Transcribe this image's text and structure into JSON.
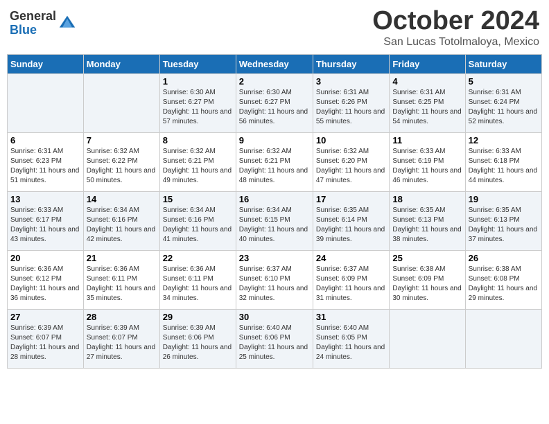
{
  "logo": {
    "general": "General",
    "blue": "Blue"
  },
  "header": {
    "month": "October 2024",
    "location": "San Lucas Totolmaloya, Mexico"
  },
  "days_of_week": [
    "Sunday",
    "Monday",
    "Tuesday",
    "Wednesday",
    "Thursday",
    "Friday",
    "Saturday"
  ],
  "weeks": [
    [
      {
        "day": "",
        "sunrise": "",
        "sunset": "",
        "daylight": ""
      },
      {
        "day": "",
        "sunrise": "",
        "sunset": "",
        "daylight": ""
      },
      {
        "day": "1",
        "sunrise": "Sunrise: 6:30 AM",
        "sunset": "Sunset: 6:27 PM",
        "daylight": "Daylight: 11 hours and 57 minutes."
      },
      {
        "day": "2",
        "sunrise": "Sunrise: 6:30 AM",
        "sunset": "Sunset: 6:27 PM",
        "daylight": "Daylight: 11 hours and 56 minutes."
      },
      {
        "day": "3",
        "sunrise": "Sunrise: 6:31 AM",
        "sunset": "Sunset: 6:26 PM",
        "daylight": "Daylight: 11 hours and 55 minutes."
      },
      {
        "day": "4",
        "sunrise": "Sunrise: 6:31 AM",
        "sunset": "Sunset: 6:25 PM",
        "daylight": "Daylight: 11 hours and 54 minutes."
      },
      {
        "day": "5",
        "sunrise": "Sunrise: 6:31 AM",
        "sunset": "Sunset: 6:24 PM",
        "daylight": "Daylight: 11 hours and 52 minutes."
      }
    ],
    [
      {
        "day": "6",
        "sunrise": "Sunrise: 6:31 AM",
        "sunset": "Sunset: 6:23 PM",
        "daylight": "Daylight: 11 hours and 51 minutes."
      },
      {
        "day": "7",
        "sunrise": "Sunrise: 6:32 AM",
        "sunset": "Sunset: 6:22 PM",
        "daylight": "Daylight: 11 hours and 50 minutes."
      },
      {
        "day": "8",
        "sunrise": "Sunrise: 6:32 AM",
        "sunset": "Sunset: 6:21 PM",
        "daylight": "Daylight: 11 hours and 49 minutes."
      },
      {
        "day": "9",
        "sunrise": "Sunrise: 6:32 AM",
        "sunset": "Sunset: 6:21 PM",
        "daylight": "Daylight: 11 hours and 48 minutes."
      },
      {
        "day": "10",
        "sunrise": "Sunrise: 6:32 AM",
        "sunset": "Sunset: 6:20 PM",
        "daylight": "Daylight: 11 hours and 47 minutes."
      },
      {
        "day": "11",
        "sunrise": "Sunrise: 6:33 AM",
        "sunset": "Sunset: 6:19 PM",
        "daylight": "Daylight: 11 hours and 46 minutes."
      },
      {
        "day": "12",
        "sunrise": "Sunrise: 6:33 AM",
        "sunset": "Sunset: 6:18 PM",
        "daylight": "Daylight: 11 hours and 44 minutes."
      }
    ],
    [
      {
        "day": "13",
        "sunrise": "Sunrise: 6:33 AM",
        "sunset": "Sunset: 6:17 PM",
        "daylight": "Daylight: 11 hours and 43 minutes."
      },
      {
        "day": "14",
        "sunrise": "Sunrise: 6:34 AM",
        "sunset": "Sunset: 6:16 PM",
        "daylight": "Daylight: 11 hours and 42 minutes."
      },
      {
        "day": "15",
        "sunrise": "Sunrise: 6:34 AM",
        "sunset": "Sunset: 6:16 PM",
        "daylight": "Daylight: 11 hours and 41 minutes."
      },
      {
        "day": "16",
        "sunrise": "Sunrise: 6:34 AM",
        "sunset": "Sunset: 6:15 PM",
        "daylight": "Daylight: 11 hours and 40 minutes."
      },
      {
        "day": "17",
        "sunrise": "Sunrise: 6:35 AM",
        "sunset": "Sunset: 6:14 PM",
        "daylight": "Daylight: 11 hours and 39 minutes."
      },
      {
        "day": "18",
        "sunrise": "Sunrise: 6:35 AM",
        "sunset": "Sunset: 6:13 PM",
        "daylight": "Daylight: 11 hours and 38 minutes."
      },
      {
        "day": "19",
        "sunrise": "Sunrise: 6:35 AM",
        "sunset": "Sunset: 6:13 PM",
        "daylight": "Daylight: 11 hours and 37 minutes."
      }
    ],
    [
      {
        "day": "20",
        "sunrise": "Sunrise: 6:36 AM",
        "sunset": "Sunset: 6:12 PM",
        "daylight": "Daylight: 11 hours and 36 minutes."
      },
      {
        "day": "21",
        "sunrise": "Sunrise: 6:36 AM",
        "sunset": "Sunset: 6:11 PM",
        "daylight": "Daylight: 11 hours and 35 minutes."
      },
      {
        "day": "22",
        "sunrise": "Sunrise: 6:36 AM",
        "sunset": "Sunset: 6:11 PM",
        "daylight": "Daylight: 11 hours and 34 minutes."
      },
      {
        "day": "23",
        "sunrise": "Sunrise: 6:37 AM",
        "sunset": "Sunset: 6:10 PM",
        "daylight": "Daylight: 11 hours and 32 minutes."
      },
      {
        "day": "24",
        "sunrise": "Sunrise: 6:37 AM",
        "sunset": "Sunset: 6:09 PM",
        "daylight": "Daylight: 11 hours and 31 minutes."
      },
      {
        "day": "25",
        "sunrise": "Sunrise: 6:38 AM",
        "sunset": "Sunset: 6:09 PM",
        "daylight": "Daylight: 11 hours and 30 minutes."
      },
      {
        "day": "26",
        "sunrise": "Sunrise: 6:38 AM",
        "sunset": "Sunset: 6:08 PM",
        "daylight": "Daylight: 11 hours and 29 minutes."
      }
    ],
    [
      {
        "day": "27",
        "sunrise": "Sunrise: 6:39 AM",
        "sunset": "Sunset: 6:07 PM",
        "daylight": "Daylight: 11 hours and 28 minutes."
      },
      {
        "day": "28",
        "sunrise": "Sunrise: 6:39 AM",
        "sunset": "Sunset: 6:07 PM",
        "daylight": "Daylight: 11 hours and 27 minutes."
      },
      {
        "day": "29",
        "sunrise": "Sunrise: 6:39 AM",
        "sunset": "Sunset: 6:06 PM",
        "daylight": "Daylight: 11 hours and 26 minutes."
      },
      {
        "day": "30",
        "sunrise": "Sunrise: 6:40 AM",
        "sunset": "Sunset: 6:06 PM",
        "daylight": "Daylight: 11 hours and 25 minutes."
      },
      {
        "day": "31",
        "sunrise": "Sunrise: 6:40 AM",
        "sunset": "Sunset: 6:05 PM",
        "daylight": "Daylight: 11 hours and 24 minutes."
      },
      {
        "day": "",
        "sunrise": "",
        "sunset": "",
        "daylight": ""
      },
      {
        "day": "",
        "sunrise": "",
        "sunset": "",
        "daylight": ""
      }
    ]
  ]
}
